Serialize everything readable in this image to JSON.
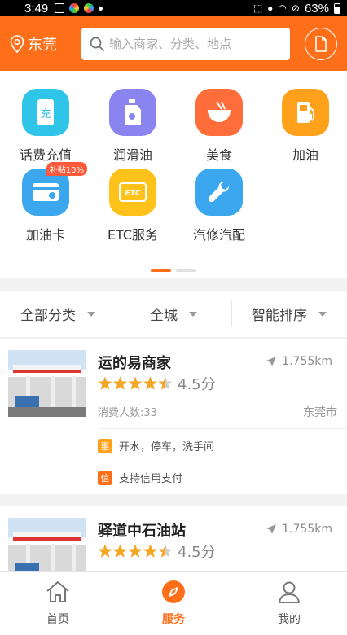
{
  "status_bar": {
    "time": "3:49",
    "battery": "63%"
  },
  "header": {
    "city": "东莞",
    "search_placeholder": "输入商家、分类、地点"
  },
  "categories": [
    {
      "label": "话费充值",
      "icon": "phone-recharge-icon",
      "color": "#2ec5e8"
    },
    {
      "label": "润滑油",
      "icon": "oil-bottle-icon",
      "color": "#8a84f0"
    },
    {
      "label": "美食",
      "icon": "food-bowl-icon",
      "color": "#ff6d3a"
    },
    {
      "label": "加油",
      "icon": "fuel-pump-icon",
      "color": "#ffa11a"
    },
    {
      "label": "加油卡",
      "icon": "fuel-card-icon",
      "color": "#3aa7ee",
      "badge": "补贴10%"
    },
    {
      "label": "ETC服务",
      "icon": "etc-card-icon",
      "color": "#ffc21a"
    },
    {
      "label": "汽修汽配",
      "icon": "wrench-icon",
      "color": "#3aa7ee"
    }
  ],
  "filters": [
    {
      "label": "全部分类"
    },
    {
      "label": "全城"
    },
    {
      "label": "智能排序"
    }
  ],
  "stations": [
    {
      "name": "运的易商家",
      "distance": "1.755km",
      "rating": 4.5,
      "score_text": "4.5分",
      "customers": "消费人数:33",
      "region": "东莞市",
      "perks": [
        {
          "tag": "惠",
          "text": "开水，停车，洗手间",
          "color": "#ffa11a"
        },
        {
          "tag": "信",
          "text": "支持信用支付",
          "color": "#ff6f19"
        }
      ]
    },
    {
      "name": "驿道中石油站",
      "distance": "1.755km",
      "rating": 4.5,
      "score_text": "4.5分"
    }
  ],
  "bottom_nav": [
    {
      "label": "首页",
      "icon": "home-icon"
    },
    {
      "label": "服务",
      "icon": "compass-icon",
      "active": true
    },
    {
      "label": "我的",
      "icon": "user-icon"
    }
  ],
  "colors": {
    "accent": "#ff6f19",
    "star": "#f5a623"
  }
}
